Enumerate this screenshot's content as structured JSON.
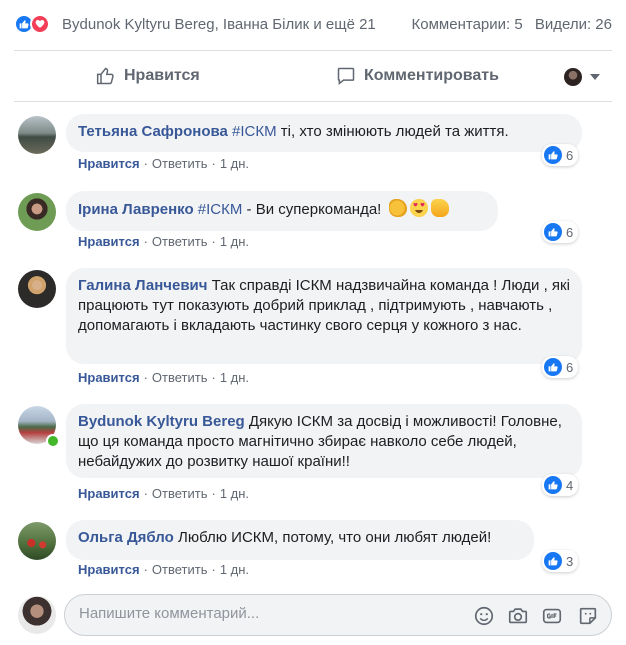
{
  "summary": {
    "reactors": "Bydunok Kyltyru Bereg, Іванна Білик и ещё 21",
    "comments_count": "Комментарии: 5",
    "views_count": "Видели: 26",
    "colors": {
      "like": "#1877f2",
      "love": "#f33e58",
      "link": "#385898"
    }
  },
  "actions": {
    "like_label": "Нравится",
    "comment_label": "Комментировать"
  },
  "comments": [
    {
      "author": "Тетьяна Сафронова",
      "hashtag": "#ІСКМ",
      "text": " ті, хто змінюють людей та життя.",
      "like_label": "Нравится",
      "reply_label": "Ответить",
      "time": "1 дн.",
      "reaction_count": "6"
    },
    {
      "author": "Ірина Лавренко",
      "hashtag": "#ІСКМ",
      "text": " - Ви суперкоманда!",
      "emojis": [
        "clapping-hands-emoji",
        "heart-eyes-emoji",
        "thumbs-up-emoji"
      ],
      "like_label": "Нравится",
      "reply_label": "Ответить",
      "time": "1 дн.",
      "reaction_count": "6"
    },
    {
      "author": "Галина Ланчевич",
      "hashtag": "",
      "text": " Так справді ІСКМ надзвичайна команда ! Люди , які працюють тут показують добрий приклад , підтримують , навчають , допомагають і вкладають частинку свого серця у кожного з нас.",
      "like_label": "Нравится",
      "reply_label": "Ответить",
      "time": "1 дн.",
      "reaction_count": "6"
    },
    {
      "author": "Bydunok Kyltyru Bereg",
      "hashtag": "",
      "text": " Дякую ІСКМ за досвід і можливості! Головне, що ця команда просто магнітично збирає навколо себе людей, небайдужих до розвитку нашої країни!!",
      "like_label": "Нравится",
      "reply_label": "Ответить",
      "time": "1 дн.",
      "reaction_count": "4"
    },
    {
      "author": "Ольга Дябло",
      "hashtag": "",
      "text": " Люблю ИСКМ, потому, что они любят людей!",
      "like_label": "Нравится",
      "reply_label": "Ответить",
      "time": "1 дн.",
      "reaction_count": "3"
    }
  ],
  "composer": {
    "placeholder": "Напишите комментарий..."
  }
}
